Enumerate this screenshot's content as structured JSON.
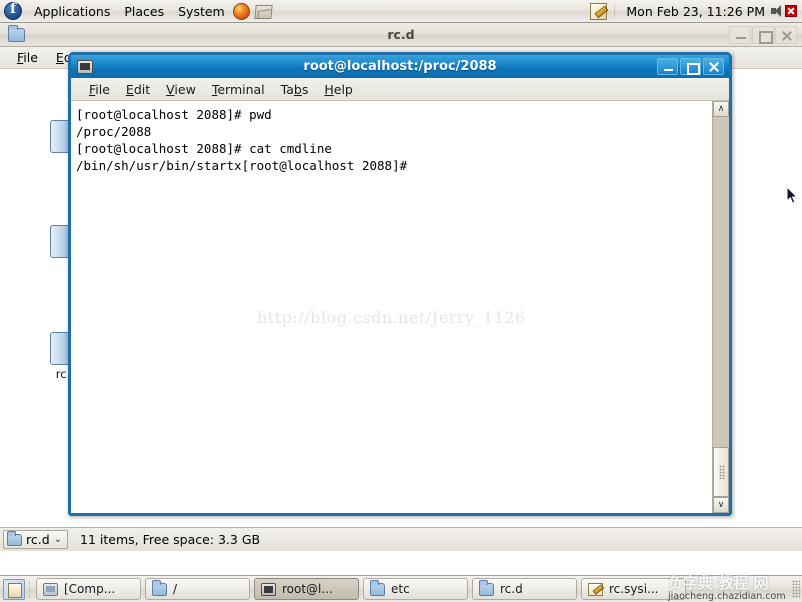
{
  "top_panel": {
    "logo_icon": "fedora-logo-icon",
    "menus": [
      "Applications",
      "Places",
      "System"
    ],
    "launchers": [
      {
        "name": "firefox-icon",
        "label": "Firefox Web Browser"
      },
      {
        "name": "evolution-mail-icon",
        "label": "Evolution Mail"
      }
    ],
    "tray": {
      "notes_icon": "sticky-notes-icon",
      "clock": "Mon Feb 23, 11:26 PM",
      "volume_icon": "volume-muted-icon"
    }
  },
  "file_manager_window": {
    "title": "rc.d",
    "title_icon": "folder-icon",
    "window_buttons": [
      {
        "name": "minimize-button",
        "glyph": "_"
      },
      {
        "name": "maximize-button",
        "glyph": "□"
      },
      {
        "name": "close-button",
        "glyph": "×"
      }
    ],
    "menus": [
      {
        "label": "File",
        "accel": "F"
      },
      {
        "label": "Edit",
        "accel": "E"
      }
    ],
    "files": [
      {
        "label": "rc."
      }
    ],
    "status_bar": {
      "path_label": "rc.d",
      "dropdown_glyph": "⌄",
      "status_text": "11 items, Free space: 3.3 GB"
    }
  },
  "terminal_window": {
    "title": "root@localhost:/proc/2088",
    "title_icon": "terminal-icon",
    "titlebar_color": "#1d8cd0",
    "border_color": "#1f6fa8",
    "window_buttons": [
      {
        "name": "minimize-button",
        "glyph": "_"
      },
      {
        "name": "maximize-button",
        "glyph": "□"
      },
      {
        "name": "close-button",
        "glyph": "×"
      }
    ],
    "menus": [
      {
        "label": "File",
        "accel": "F"
      },
      {
        "label": "Edit",
        "accel": "E"
      },
      {
        "label": "View",
        "accel": "V"
      },
      {
        "label": "Terminal",
        "accel": "T"
      },
      {
        "label": "Tabs",
        "accel": "b"
      },
      {
        "label": "Help",
        "accel": "H"
      }
    ],
    "screen_text": "[root@localhost 2088]# pwd\n/proc/2088\n[root@localhost 2088]# cat cmdline\n/bin/sh/usr/bin/startx[root@localhost 2088]#",
    "scrollbar": {
      "up_glyph": "∧",
      "down_glyph": "∨"
    }
  },
  "watermarks": {
    "url": "http://blog.csdn.net/Jerry_1126",
    "logo_cn": "负字典 教程 网",
    "logo_en": "jiaocheng.chazidian.com"
  },
  "bottom_panel": {
    "show_desktop_icon": "show-desktop-icon",
    "tasks": [
      {
        "label": "[Comp...",
        "icon": "computer-icon",
        "active": false
      },
      {
        "label": "/",
        "icon": "folder-icon",
        "active": false
      },
      {
        "label": "root@l...",
        "icon": "terminal-icon",
        "active": true
      },
      {
        "label": "etc",
        "icon": "folder-icon",
        "active": false
      },
      {
        "label": "rc.d",
        "icon": "folder-icon",
        "active": false
      },
      {
        "label": "rc.sysi...",
        "icon": "document-icon",
        "active": false
      }
    ]
  }
}
